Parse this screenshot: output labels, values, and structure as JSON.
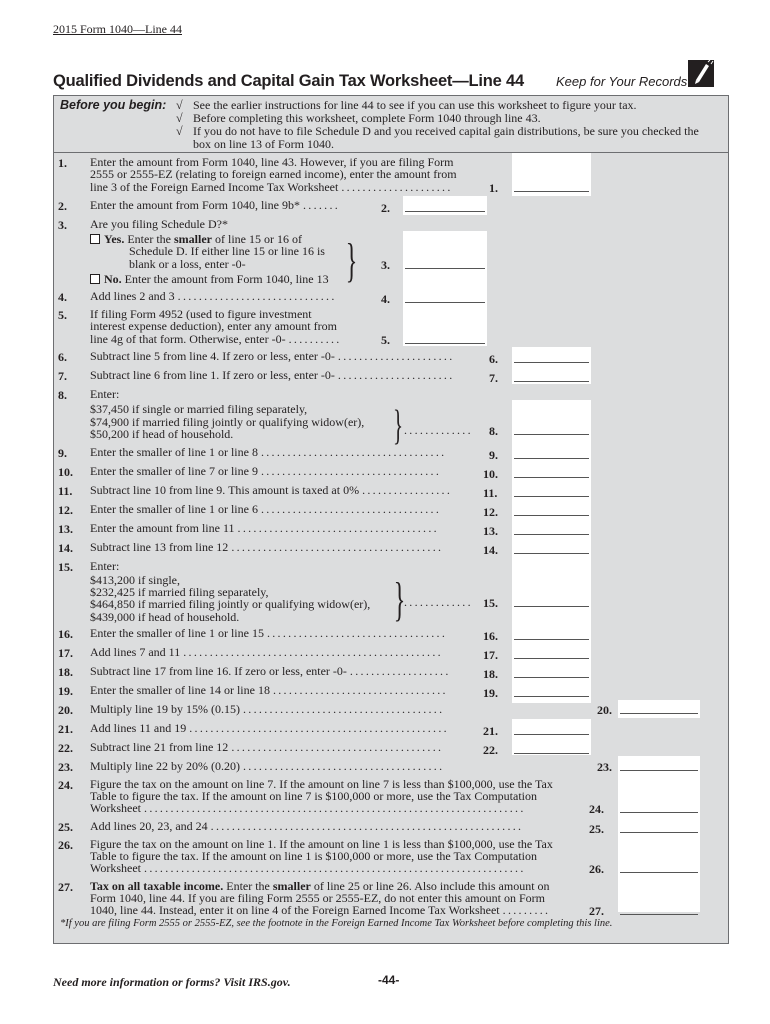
{
  "header": {
    "form_reference": "2015 Form 1040—Line 44",
    "title": "Qualified Dividends and Capital Gain Tax Worksheet—Line 44",
    "keep_records": "Keep for Your Records",
    "keep_records_icon": "pencil-icon"
  },
  "before_you_begin": {
    "label": "Before you begin:",
    "check_mark": "√",
    "items": [
      "See the earlier instructions for line 44 to see if you can use this worksheet to figure your tax.",
      "Before completing this worksheet, complete Form 1040 through line 43.",
      "If you do not have to file Schedule D and you received capital gain distributions, be sure you checked the box on line 13 of Form 1040."
    ]
  },
  "lines": {
    "l1": {
      "num": "1.",
      "text": [
        "Enter the amount from Form 1040, line 43. However, if you are filing Form",
        "2555 or 2555-EZ (relating to foreign earned income), enter the amount from",
        "line 3 of the Foreign Earned Income Tax Worksheet"
      ],
      "ref": "1.",
      "value": ""
    },
    "l2": {
      "num": "2.",
      "text": "Enter the amount from Form 1040, line 9b*",
      "ref": "2.",
      "value": ""
    },
    "l3": {
      "num": "3.",
      "text": "Are you filing Schedule D?*",
      "ref": "3.",
      "value": "",
      "yes_label": "Yes.",
      "yes_text_a": "Enter the ",
      "yes_text_bold": "smaller",
      "yes_text_b": " of line 15 or 16 of",
      "yes_text_2": "Schedule D. If either line 15 or line 16 is",
      "yes_text_3": "blank or a loss, enter -0-",
      "no_label": "No.",
      "no_text": "Enter the amount from Form 1040, line 13",
      "yes_checked": false,
      "no_checked": false
    },
    "l4": {
      "num": "4.",
      "text": "Add lines 2 and 3",
      "ref": "4.",
      "value": ""
    },
    "l5": {
      "num": "5.",
      "text": [
        "If filing Form 4952 (used to figure investment",
        "interest expense deduction), enter any amount from",
        "line 4g of that form. Otherwise, enter -0-"
      ],
      "ref": "5.",
      "value": ""
    },
    "l6": {
      "num": "6.",
      "text": "Subtract line 5 from line 4. If zero or less, enter -0-",
      "ref": "6.",
      "value": ""
    },
    "l7": {
      "num": "7.",
      "text": "Subtract line 6 from line 1. If zero or less, enter -0-",
      "ref": "7.",
      "value": ""
    },
    "l8": {
      "num": "8.",
      "text": "Enter:",
      "options": [
        "$37,450 if single or married filing separately,",
        "$74,900 if married filing jointly or qualifying widow(er),",
        "$50,200 if head of household."
      ],
      "ref": "8.",
      "value": ""
    },
    "l9": {
      "num": "9.",
      "text": "Enter the smaller of line 1 or line 8",
      "ref": "9.",
      "value": ""
    },
    "l10": {
      "num": "10.",
      "text": "Enter the smaller of line 7 or line 9",
      "ref": "10.",
      "value": ""
    },
    "l11": {
      "num": "11.",
      "text": "Subtract line 10 from line 9. This amount is taxed at 0%",
      "ref": "11.",
      "value": ""
    },
    "l12": {
      "num": "12.",
      "text": "Enter the smaller of line 1 or line 6",
      "ref": "12.",
      "value": ""
    },
    "l13": {
      "num": "13.",
      "text": "Enter the amount from line 11",
      "ref": "13.",
      "value": ""
    },
    "l14": {
      "num": "14.",
      "text": "Subtract line 13 from line 12",
      "ref": "14.",
      "value": ""
    },
    "l15": {
      "num": "15.",
      "text": "Enter:",
      "options": [
        "$413,200 if single,",
        "$232,425 if married filing separately,",
        "$464,850 if married filing jointly or qualifying widow(er),",
        "$439,000 if head of household."
      ],
      "ref": "15.",
      "value": ""
    },
    "l16": {
      "num": "16.",
      "text": "Enter the smaller of line 1 or line 15",
      "ref": "16.",
      "value": ""
    },
    "l17": {
      "num": "17.",
      "text": "Add lines 7 and 11",
      "ref": "17.",
      "value": ""
    },
    "l18": {
      "num": "18.",
      "text": "Subtract line 17 from line 16. If zero or less, enter -0-",
      "ref": "18.",
      "value": ""
    },
    "l19": {
      "num": "19.",
      "text": "Enter the smaller of line 14 or line 18",
      "ref": "19.",
      "value": ""
    },
    "l20": {
      "num": "20.",
      "text": "Multiply line 19 by 15% (0.15)",
      "ref": "20.",
      "value": ""
    },
    "l21": {
      "num": "21.",
      "text": "Add lines 11 and 19",
      "ref": "21.",
      "value": ""
    },
    "l22": {
      "num": "22.",
      "text": "Subtract line 21 from line 12",
      "ref": "22.",
      "value": ""
    },
    "l23": {
      "num": "23.",
      "text": "Multiply line 22 by 20% (0.20)",
      "ref": "23.",
      "value": ""
    },
    "l24": {
      "num": "24.",
      "text": [
        "Figure the tax on the amount on line 7. If the amount on line 7 is less than $100,000, use the Tax",
        "Table to figure the tax. If the amount on line 7 is $100,000 or more, use the Tax Computation",
        "Worksheet"
      ],
      "ref": "24.",
      "value": ""
    },
    "l25": {
      "num": "25.",
      "text": "Add lines 20, 23, and 24",
      "ref": "25.",
      "value": ""
    },
    "l26": {
      "num": "26.",
      "text": [
        "Figure the tax on the amount on line 1. If the amount on line 1 is less than $100,000, use the Tax",
        "Table to figure the tax. If the amount on line 1 is $100,000 or more, use the Tax Computation",
        "Worksheet"
      ],
      "ref": "26.",
      "value": ""
    },
    "l27": {
      "num": "27.",
      "bold_lead": "Tax on all taxable income.",
      "text_a": " Enter the ",
      "text_bold": "smaller",
      "text_b": " of line 25 or line 26. Also include this amount on",
      "text_2": "Form 1040, line 44. If you are filing Form 2555 or 2555-EZ, do not enter this amount on Form",
      "text_3": "1040, line 44. Instead, enter it on line 4 of the Foreign Earned Income Tax Worksheet",
      "ref": "27.",
      "value": ""
    }
  },
  "footnote": "*If you are filing Form 2555 or 2555-EZ, see the footnote in the Foreign Earned Income Tax Worksheet before completing this line.",
  "footer": {
    "more_info": "Need more information or forms? Visit IRS.gov.",
    "page_number": "-44-"
  },
  "colors": {
    "panel_background": "#dcddde",
    "field_background": "#ffffff",
    "border": "#6d6e71",
    "text": "#231f20"
  }
}
